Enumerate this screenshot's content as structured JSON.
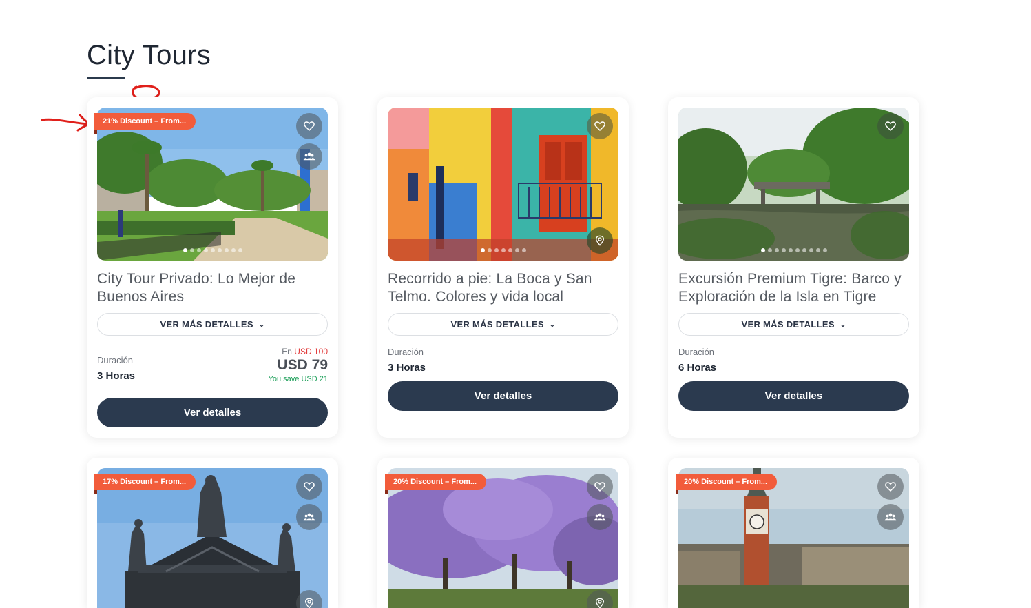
{
  "page": {
    "title": "City Tours"
  },
  "cards": [
    {
      "badge": "21% Discount – From...",
      "title": "City Tour Privado: Lo Mejor de Buenos Aires",
      "more_label": "VER MÁS DETALLES",
      "duration_label": "Duración",
      "duration_value": "3 Horas",
      "price_prefix": "En",
      "price_old": "USD 100",
      "price_now": "USD 79",
      "price_save": "You save USD 21",
      "cta": "Ver detalles",
      "icons": [
        "heart-icon",
        "group-icon"
      ],
      "photo": "plaza-park"
    },
    {
      "title": "Recorrido a pie: La Boca y San Telmo. Colores y vida local",
      "more_label": "VER MÁS DETALLES",
      "duration_label": "Duración",
      "duration_value": "3 Horas",
      "cta": "Ver detalles",
      "icons": [
        "heart-icon",
        "location-pin-icon"
      ],
      "photo": "colorful-houses"
    },
    {
      "title": "Excursión Premium Tigre: Barco y Exploración de la Isla en Tigre",
      "more_label": "VER MÁS DETALLES",
      "duration_label": "Duración",
      "duration_value": "6 Horas",
      "cta": "Ver detalles",
      "icons": [
        "heart-icon"
      ],
      "photo": "river-delta"
    },
    {
      "badge": "17% Discount – From...",
      "icons": [
        "heart-icon",
        "group-icon",
        "location-pin-icon"
      ],
      "photo": "statues-monument"
    },
    {
      "badge": "20% Discount – From...",
      "icons": [
        "heart-icon",
        "group-icon",
        "location-pin-icon"
      ],
      "photo": "jacaranda-trees"
    },
    {
      "badge": "20% Discount – From...",
      "icons": [
        "heart-icon",
        "group-icon"
      ],
      "photo": "clock-tower"
    }
  ],
  "colors": {
    "badge": "#f25c3b",
    "cta": "#2b3a4f",
    "save": "#1ea05a",
    "old_price": "#e23b3b",
    "annotation": "#e0201b"
  }
}
